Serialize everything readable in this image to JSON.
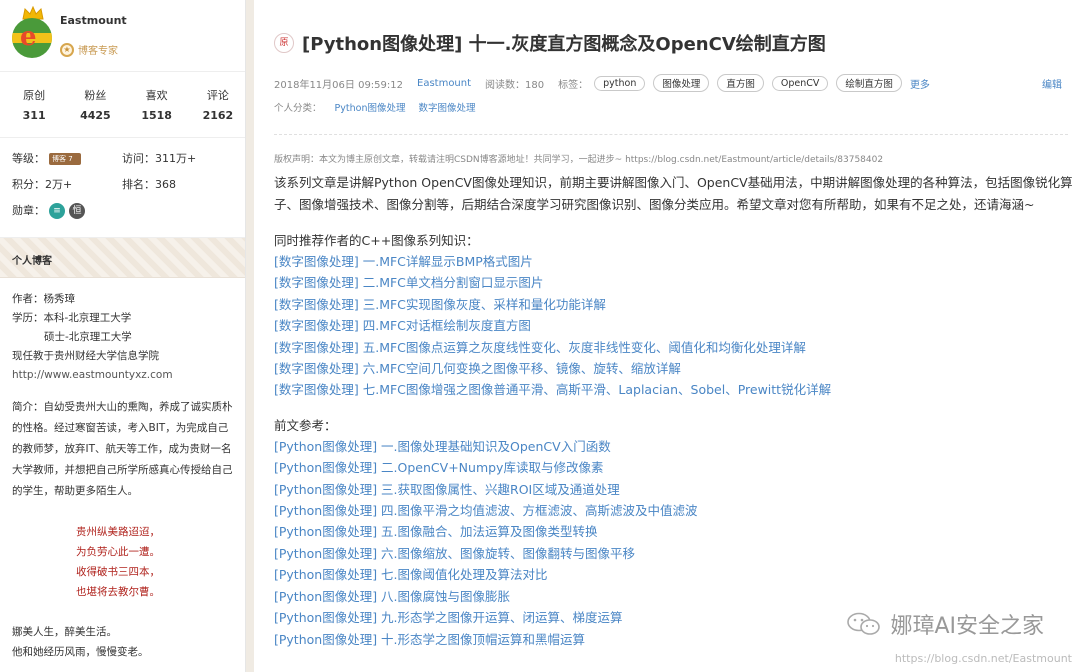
{
  "sidebar": {
    "username": "Eastmount",
    "expert_label": "博客专家",
    "stats": [
      {
        "label": "原创",
        "value": "311"
      },
      {
        "label": "粉丝",
        "value": "4425"
      },
      {
        "label": "喜欢",
        "value": "1518"
      },
      {
        "label": "评论",
        "value": "2162"
      }
    ],
    "grade_label": "等级：",
    "visits_label": "访问：",
    "visits_value": "311万+",
    "points_label": "积分：",
    "points_value": "2万+",
    "rank_label": "排名：",
    "rank_value": "368",
    "medals_label": "勋章：",
    "blog_heading": "个人博客",
    "author_line": "作者：杨秀璋",
    "edu_line1": "学历：本科-北京理工大学",
    "edu_line2": "硕士-北京理工大学",
    "job_line": "现任教于贵州财经大学信息学院",
    "site_url": "http://www.eastmountyxz.com",
    "intro": "简介：自幼受贵州大山的熏陶，养成了诚实质朴的性格。经过寒窗苦读，考入BIT，为完成自己的教师梦，放弃IT、航天等工作，成为贵财一名大学教师，并想把自己所学所感真心传授给自己的学生，帮助更多陌生人。",
    "poem": [
      "贵州纵美路迢迢，",
      "为负劳心此一遭。",
      "收得破书三四本，",
      "也堪将去教尔曹。"
    ],
    "bio_end1": "娜美人生，醉美生活。",
    "bio_end2": "他和她经历风雨，慢慢变老。"
  },
  "article": {
    "original_badge": "原",
    "title": "[Python图像处理] 十一.灰度直方图概念及OpenCV绘制直方图",
    "date": "2018年11月06日 09:59:12",
    "author": "Eastmount",
    "reads": "阅读数：180",
    "tags_label": "标签：",
    "tags": [
      "python",
      "图像处理",
      "直方图",
      "OpenCV",
      "绘制直方图"
    ],
    "more": "更多",
    "edit": "编辑",
    "category_label": "个人分类：",
    "categories": [
      "Python图像处理",
      "数字图像处理"
    ],
    "copyright": "版权声明：本文为博主原创文章，转载请注明CSDN博客源地址！共同学习，一起进步~ https://blog.csdn.net/Eastmount/article/details/83758402",
    "intro": "该系列文章是讲解Python OpenCV图像处理知识，前期主要讲解图像入门、OpenCV基础用法，中期讲解图像处理的各种算法，包括图像锐化算子、图像增强技术、图像分割等，后期结合深度学习研究图像识别、图像分类应用。希望文章对您有所帮助，如果有不足之处，还请海涵~",
    "cpp_heading": "同时推荐作者的C++图像系列知识：",
    "cpp_links": [
      "[数字图像处理] 一.MFC详解显示BMP格式图片",
      "[数字图像处理] 二.MFC单文档分割窗口显示图片",
      "[数字图像处理] 三.MFC实现图像灰度、采样和量化功能详解",
      "[数字图像处理] 四.MFC对话框绘制灰度直方图",
      "[数字图像处理] 五.MFC图像点运算之灰度线性变化、灰度非线性变化、阈值化和均衡化处理详解",
      "[数字图像处理] 六.MFC空间几何变换之图像平移、镜像、旋转、缩放详解",
      "[数字图像处理] 七.MFC图像增强之图像普通平滑、高斯平滑、Laplacian、Sobel、Prewitt锐化详解"
    ],
    "prev_heading": "前文参考：",
    "prev_links": [
      "[Python图像处理] 一.图像处理基础知识及OpenCV入门函数",
      "[Python图像处理] 二.OpenCV+Numpy库读取与修改像素",
      "[Python图像处理] 三.获取图像属性、兴趣ROI区域及通道处理",
      "[Python图像处理] 四.图像平滑之均值滤波、方框滤波、高斯滤波及中值滤波",
      "[Python图像处理] 五.图像融合、加法运算及图像类型转换",
      "[Python图像处理] 六.图像缩放、图像旋转、图像翻转与图像平移",
      "[Python图像处理] 七.图像阈值化处理及算法对比",
      "[Python图像处理] 八.图像腐蚀与图像膨胀",
      "[Python图像处理] 九.形态学之图像开运算、闭运算、梯度运算",
      "[Python图像处理] 十.形态学之图像顶帽运算和黑帽运算"
    ]
  },
  "watermark": {
    "brand": "娜璋AI安全之家",
    "url": "https://blog.csdn.net/Eastmount"
  }
}
